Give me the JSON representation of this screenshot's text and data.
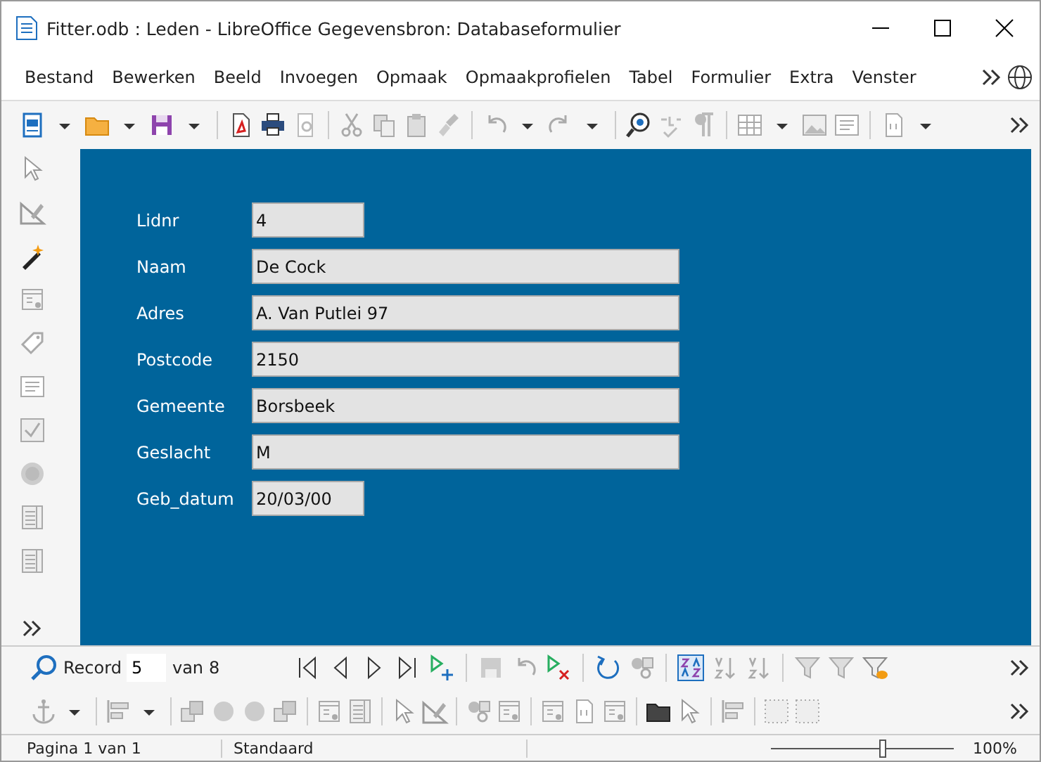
{
  "window": {
    "title": "Fitter.odb : Leden - LibreOffice Gegevensbron: Databaseformulier"
  },
  "menu": [
    {
      "label": "Bestand"
    },
    {
      "label": "Bewerken"
    },
    {
      "label": "Beeld"
    },
    {
      "label": "Invoegen"
    },
    {
      "label": "Opmaak"
    },
    {
      "label": "Opmaakprofielen"
    },
    {
      "label": "Tabel"
    },
    {
      "label": "Formulier"
    },
    {
      "label": "Extra"
    },
    {
      "label": "Venster"
    }
  ],
  "form": {
    "fields": [
      {
        "label": "Lidnr",
        "value": "4",
        "kind": "short"
      },
      {
        "label": "Naam",
        "value": "De Cock",
        "kind": "long"
      },
      {
        "label": "Adres",
        "value": "A. Van Putlei 97",
        "kind": "long"
      },
      {
        "label": "Postcode",
        "value": "2150",
        "kind": "long"
      },
      {
        "label": "Gemeente",
        "value": "Borsbeek",
        "kind": "long"
      },
      {
        "label": "Geslacht",
        "value": "M",
        "kind": "long"
      },
      {
        "label": "Geb_datum",
        "value": "20/03/00",
        "kind": "short"
      }
    ]
  },
  "navigation": {
    "label": "Record",
    "value": "5",
    "of": "van",
    "total": "8"
  },
  "status_bar": {
    "page": "Pagina 1 van 1",
    "style": "Standaard",
    "zoom": {
      "level": 0.62,
      "reading": "100%"
    }
  }
}
